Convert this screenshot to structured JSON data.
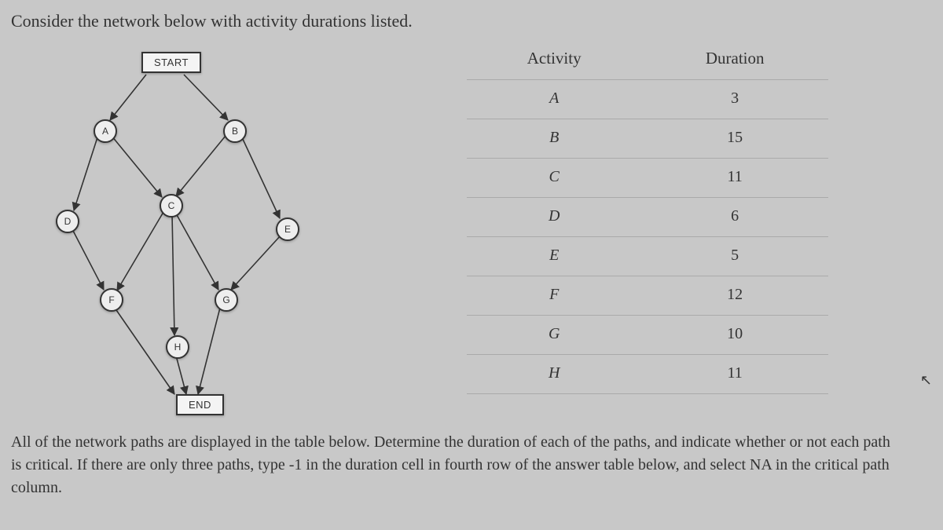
{
  "title": "Consider the network below with activity durations listed.",
  "table": {
    "headers": {
      "activity": "Activity",
      "duration": "Duration"
    },
    "rows": [
      {
        "activity": "A",
        "duration": "3"
      },
      {
        "activity": "B",
        "duration": "15"
      },
      {
        "activity": "C",
        "duration": "11"
      },
      {
        "activity": "D",
        "duration": "6"
      },
      {
        "activity": "E",
        "duration": "5"
      },
      {
        "activity": "F",
        "duration": "12"
      },
      {
        "activity": "G",
        "duration": "10"
      },
      {
        "activity": "H",
        "duration": "11"
      }
    ]
  },
  "diagram": {
    "start": "START",
    "end": "END",
    "nodes": {
      "A": "A",
      "B": "B",
      "C": "C",
      "D": "D",
      "E": "E",
      "F": "F",
      "G": "G",
      "H": "H"
    }
  },
  "instructions": "All of the network paths are displayed in the table below. Determine the duration of each of the paths, and indicate whether or not each path is critical. If there are only three paths, type -1 in the duration cell in fourth row of the answer table below, and select NA in the critical path column.",
  "cursor": "↖"
}
